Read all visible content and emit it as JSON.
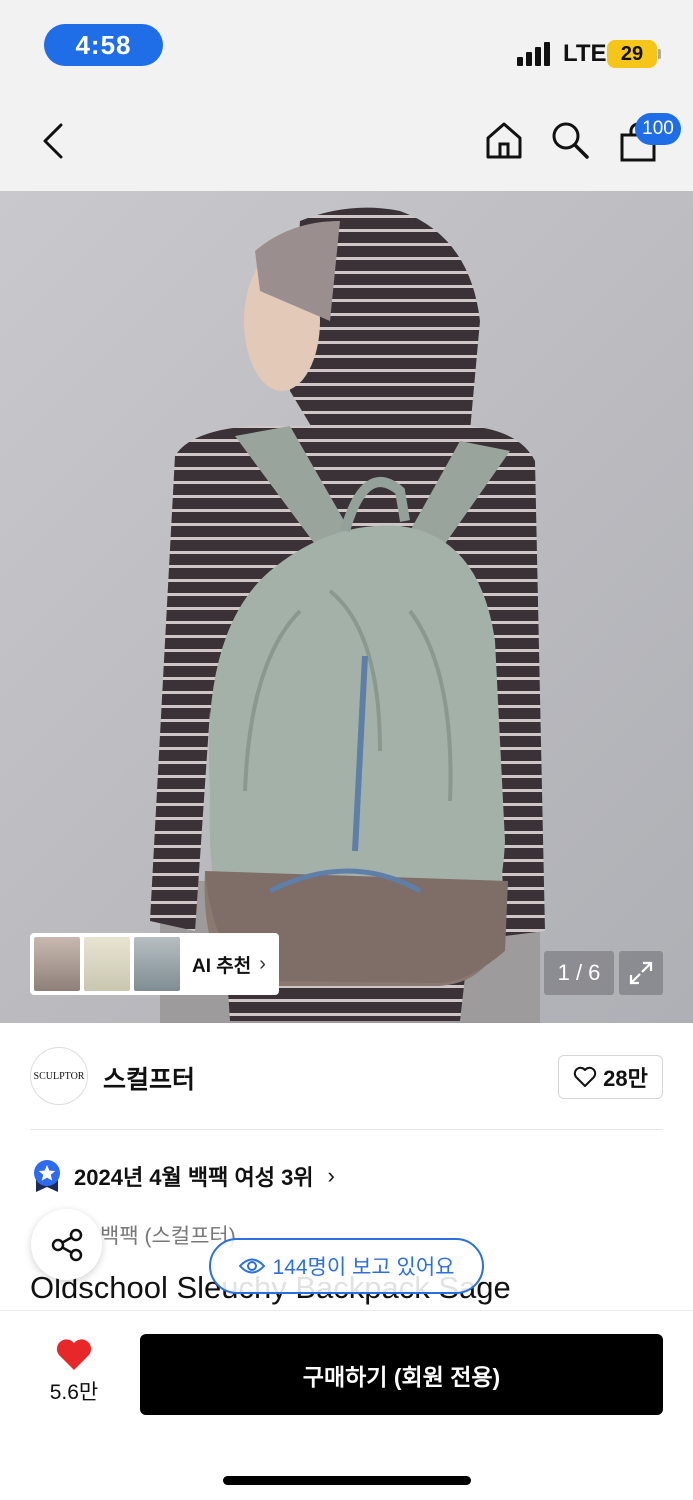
{
  "status_bar": {
    "time": "4:58",
    "network": "LTE",
    "battery": "29"
  },
  "nav": {
    "cart_count": "100",
    "icons": [
      "back-icon",
      "home-icon",
      "search-icon",
      "shopping-bag-icon"
    ]
  },
  "gallery": {
    "counter": "1 / 6",
    "ai_label": "AI 추천"
  },
  "brand": {
    "logo_text": "SCULPTOR",
    "name": "스컬프터",
    "likes": "28만"
  },
  "ranking": {
    "text": "2024년 4월 백팩 여성 3위"
  },
  "product": {
    "category": "백팩 (스컬프터)",
    "title": "Oldschool Sleuchy Backpack Sage"
  },
  "overlay": {
    "viewers": "144명이 보고 있어요"
  },
  "bottom": {
    "wish_count": "5.6만",
    "buy_label": "구매하기 (회원 전용)"
  },
  "colors": {
    "accent": "#1f6ee8",
    "heart": "#e8272b",
    "buy_button": "#000000"
  }
}
